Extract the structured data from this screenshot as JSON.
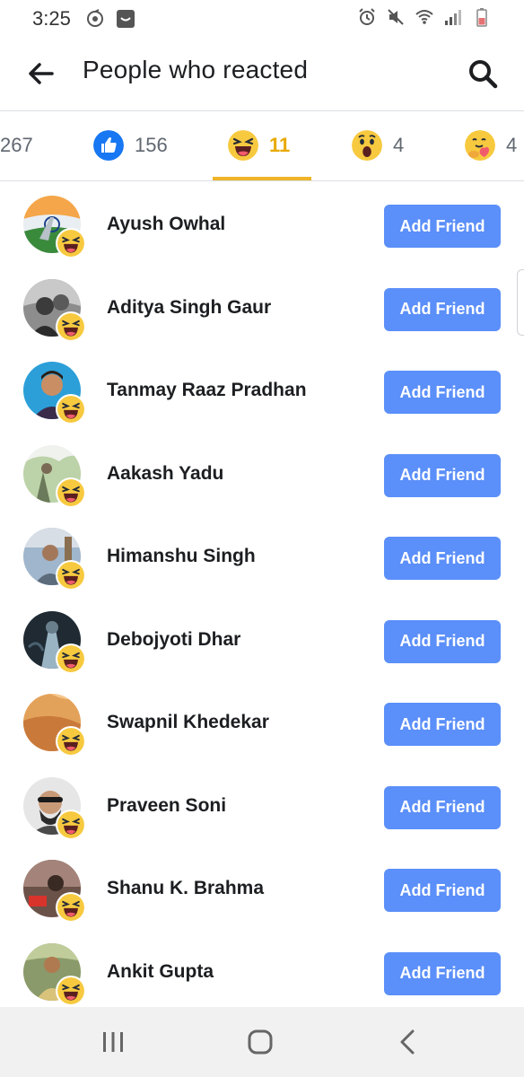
{
  "status_bar": {
    "time": "3:25",
    "left_icons": [
      "sync-icon",
      "notification-app-icon"
    ],
    "right_icons": [
      "alarm-icon",
      "mute-icon",
      "wifi-icon",
      "signal-icon",
      "battery-icon"
    ]
  },
  "header": {
    "title": "People who reacted",
    "back_icon": "arrow-left-icon",
    "search_icon": "search-icon"
  },
  "tabs": [
    {
      "reaction": "all",
      "count": "267",
      "active": false
    },
    {
      "reaction": "like",
      "count": "156",
      "active": false
    },
    {
      "reaction": "haha",
      "count": "11",
      "active": true
    },
    {
      "reaction": "wow",
      "count": "4",
      "active": false
    },
    {
      "reaction": "care",
      "count": "4",
      "active": false
    }
  ],
  "people": [
    {
      "name": "Ayush Owhal",
      "button": "Add Friend",
      "reaction": "haha"
    },
    {
      "name": "Aditya Singh Gaur",
      "button": "Add Friend",
      "reaction": "haha"
    },
    {
      "name": "Tanmay Raaz Pradhan",
      "button": "Add Friend",
      "reaction": "haha"
    },
    {
      "name": "Aakash Yadu",
      "button": "Add Friend",
      "reaction": "haha"
    },
    {
      "name": "Himanshu Singh",
      "button": "Add Friend",
      "reaction": "haha"
    },
    {
      "name": "Debojyoti Dhar",
      "button": "Add Friend",
      "reaction": "haha"
    },
    {
      "name": "Swapnil Khedekar",
      "button": "Add Friend",
      "reaction": "haha"
    },
    {
      "name": "Praveen Soni",
      "button": "Add Friend",
      "reaction": "haha"
    },
    {
      "name": "Shanu K. Brahma",
      "button": "Add Friend",
      "reaction": "haha"
    },
    {
      "name": "Ankit Gupta",
      "button": "Add Friend",
      "reaction": "haha"
    }
  ],
  "nav_bar": {
    "icons": [
      "recent-apps-icon",
      "home-icon",
      "back-nav-icon"
    ]
  },
  "colors": {
    "accent_active_tab": "#e8a900",
    "tab_underline": "#f0b429",
    "button_bg": "#5b8ff9",
    "like_blue": "#1877f2"
  }
}
